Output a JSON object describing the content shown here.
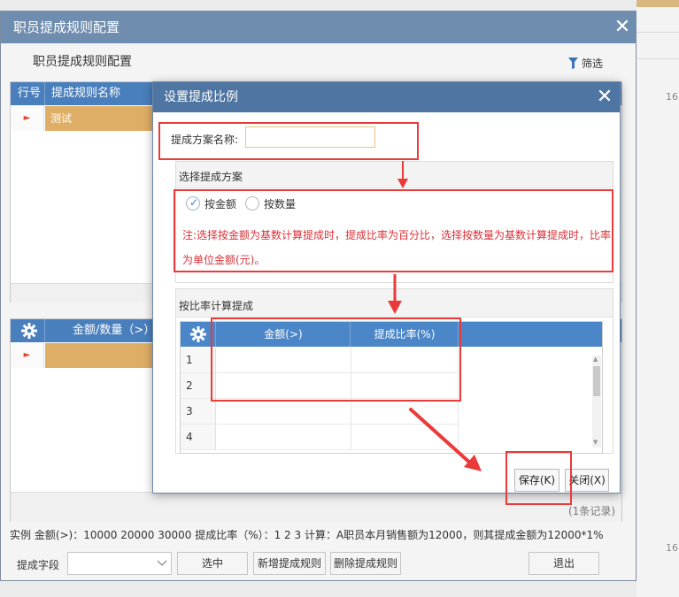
{
  "background": {
    "row_numbers": [
      "16",
      "16"
    ]
  },
  "outer_window": {
    "title": "职员提成规则配置",
    "close_glyph": "✕",
    "panel_title": "职员提成规则配置",
    "filter_label": "筛选",
    "rules_grid": {
      "columns": [
        "行号",
        "提成规则名称"
      ],
      "rows": [
        {
          "marker": "►",
          "name": "测试"
        }
      ]
    },
    "detail_grid": {
      "columns": [
        "金额/数量（>）"
      ],
      "rows": [
        {
          "marker": "►"
        }
      ],
      "count_text": "(1条记录)"
    },
    "example_text": "实例 金额(>)：10000 20000 30000 提成比率（%）：1 2 3 计算：A职员本月销售额为12000，则其提成金额为12000*1%",
    "field_label": "提成字段",
    "select_value": "",
    "buttons": {
      "select": "选中",
      "add_rule": "新增提成规则",
      "delete_rule": "删除提成规则",
      "exit": "退出"
    }
  },
  "modal": {
    "title": "设置提成比例",
    "close_glyph": "✕",
    "name_label": "提成方案名称:",
    "name_value": "",
    "scheme_section": {
      "title": "选择提成方案",
      "options": [
        {
          "label": "按金额",
          "checked": true
        },
        {
          "label": "按数量",
          "checked": false
        }
      ],
      "note": "注:选择按金额为基数计算提成时，提成比率为百分比，选择按数量为基数计算提成时，比率为单位金额(元)。"
    },
    "ratio_section": {
      "title": "按比率计算提成",
      "columns": [
        "金额(>)",
        "提成比率(%)"
      ],
      "rows": [
        {
          "num": "1",
          "amount": "",
          "rate": ""
        },
        {
          "num": "2",
          "amount": "",
          "rate": ""
        },
        {
          "num": "3",
          "amount": "",
          "rate": ""
        },
        {
          "num": "4",
          "amount": "",
          "rate": ""
        }
      ]
    },
    "buttons": {
      "save": "保存(K)",
      "close": "关闭(X)"
    }
  },
  "colors": {
    "window_title": "#6f8dae",
    "modal_title": "#4f75a3",
    "grid_header": "#4a86c8",
    "selected_row": "#dfae66",
    "note_red": "#d8313a",
    "annotation_red": "#ea3a3a"
  }
}
